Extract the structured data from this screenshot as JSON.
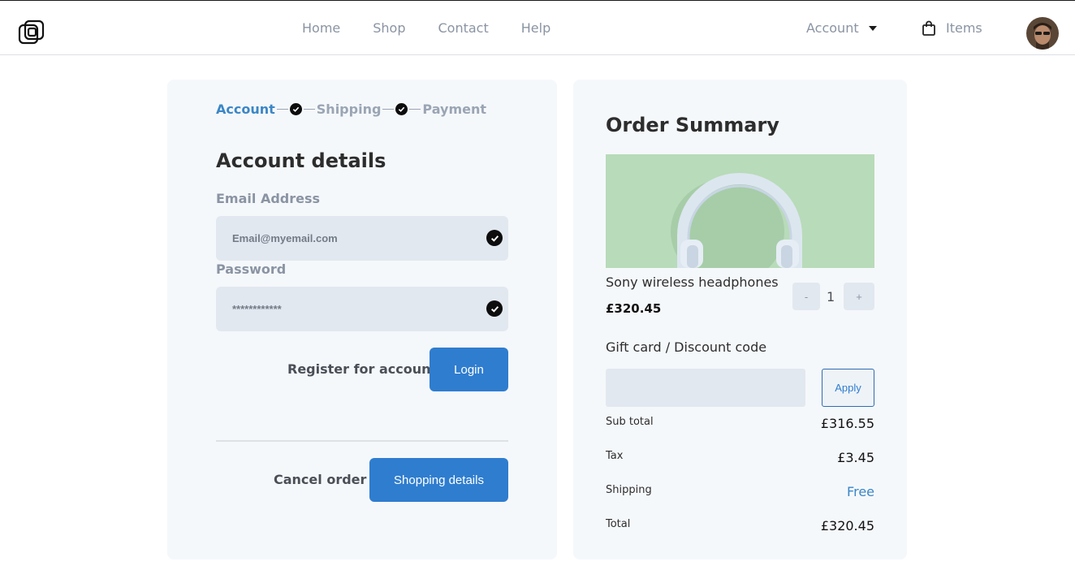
{
  "nav": {
    "links": [
      "Home",
      "Shop",
      "Contact",
      "Help"
    ],
    "account_label": "Account",
    "cart_label": "Items"
  },
  "steps": {
    "items": [
      "Account",
      "Shipping",
      "Payment"
    ]
  },
  "account_form": {
    "heading": "Account details",
    "email_label": "Email Address",
    "email_value": "Email@myemail.com",
    "password_label": "Password",
    "password_value": "************",
    "register_label": "Register for account",
    "login_label": "Login",
    "cancel_label": "Cancel order",
    "next_label": "Shopping details"
  },
  "order": {
    "heading": "Order Summary",
    "product_name": "Sony wireless headphones",
    "product_price": "£320.45",
    "qty_minus": "-",
    "qty_value": "1",
    "qty_plus": "+",
    "gift_label": "Gift card / Discount code",
    "apply_label": "Apply",
    "subtotal_label": "Sub total",
    "subtotal_value": "£316.55",
    "tax_label": "Tax",
    "tax_value": "£3.45",
    "shipping_label": "Shipping",
    "shipping_value": "Free",
    "total_label": "Total",
    "total_value": "£320.45"
  },
  "colors": {
    "accent": "#2f7dcf",
    "panel": "#f5f8fb",
    "input": "#e2e8f0",
    "product_bg": "#b8dbb9"
  }
}
